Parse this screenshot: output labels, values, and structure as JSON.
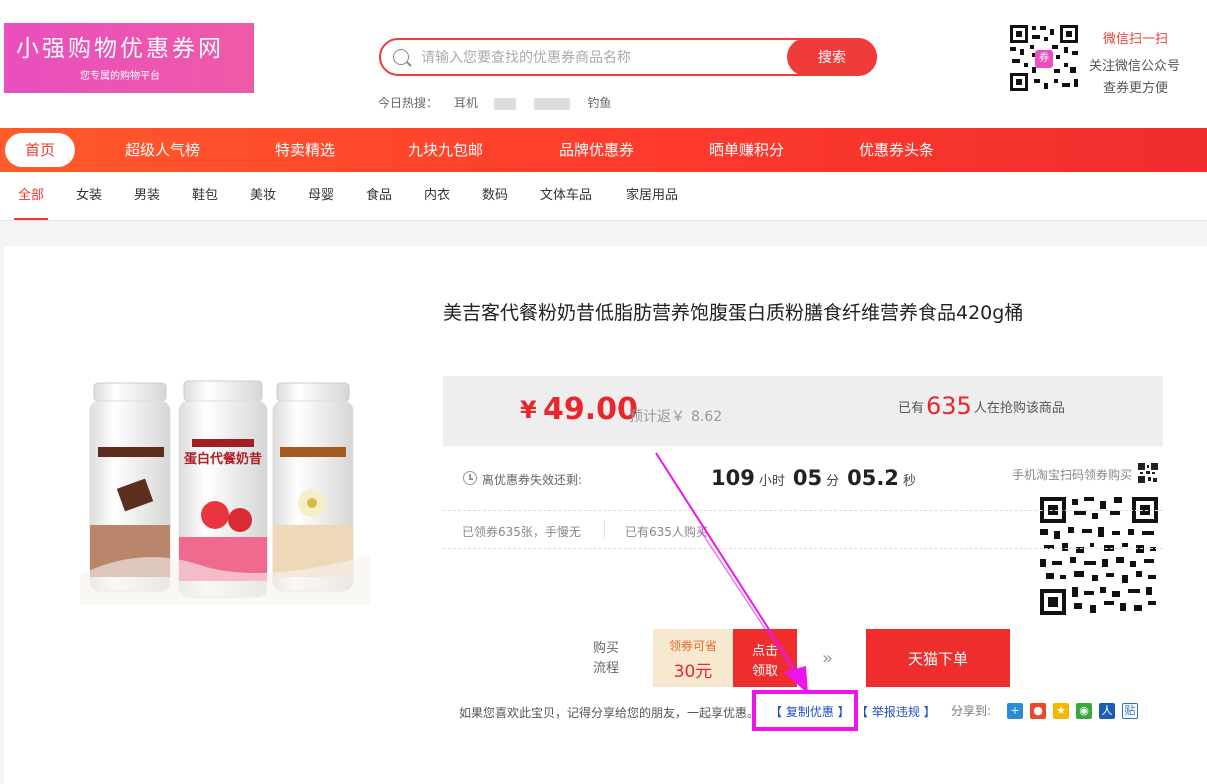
{
  "site": {
    "logo_title": "小强购物优惠券网",
    "logo_subtitle": "您专属的购物平台"
  },
  "search": {
    "placeholder": "请输入您要查找的优惠券商品名称",
    "button": "搜索",
    "hot_label": "今日热搜：",
    "hot_terms": [
      "耳机",
      "钓鱼"
    ]
  },
  "wechat": {
    "scan": "微信扫一扫",
    "follow": "关注微信公众号",
    "more": "查券更方便",
    "qr_badge": "券"
  },
  "nav": {
    "items": [
      "首页",
      "超级人气榜",
      "特卖精选",
      "九块九包邮",
      "品牌优惠券",
      "晒单赚积分",
      "优惠券头条"
    ],
    "active_index": 0
  },
  "categories": {
    "items": [
      "全部",
      "女装",
      "男装",
      "鞋包",
      "美妆",
      "母婴",
      "食品",
      "内衣",
      "数码",
      "文体车品",
      "家居用品"
    ],
    "active_index": 0
  },
  "product": {
    "title": "美吉客代餐粉奶昔低脂肪营养饱腹蛋白质粉膳食纤维营养食品420g桶",
    "currency": "¥",
    "price": "49.00",
    "rebate_label": "预计返￥",
    "rebate_value": "8.62",
    "buyers_prefix": "已有",
    "buyers_count": "635",
    "buyers_suffix": "人在抢购该商品",
    "image_label": "蛋白代餐奶昔"
  },
  "countdown": {
    "label": "离优惠券失效还剩:",
    "hours": "109",
    "hours_unit": "小时",
    "minutes": "05",
    "minutes_unit": "分",
    "seconds": "05.2",
    "seconds_unit": "秒"
  },
  "stats": {
    "claimed": "已领券635张，手慢无",
    "bought": "已有635人购买"
  },
  "mobile": {
    "scan_text": "手机淘宝扫码领券购买"
  },
  "purchase_flow": {
    "label_line1": "购买",
    "label_line2": "流程",
    "coupon_label": "领券可省",
    "coupon_amount": "30元",
    "claim_line1": "点击",
    "claim_line2": "领取",
    "arrows": "»",
    "order_button": "天猫下单"
  },
  "share": {
    "text": "如果您喜欢此宝贝，记得分享给您的朋友，一起享优惠。",
    "copy_link": "【 复制优惠 】",
    "report_link": "【 举报违规 】",
    "share_label": "分享到:"
  },
  "colors": {
    "primary_red": "#f03b2c",
    "logo_pink": "#e94fbe",
    "highlight_magenta": "#ee14ee",
    "link_blue": "#1b4fc9"
  },
  "share_icons": [
    "plus-icon",
    "weibo-icon",
    "qzone-icon",
    "wechat-icon",
    "renren-icon",
    "tieba-icon"
  ]
}
